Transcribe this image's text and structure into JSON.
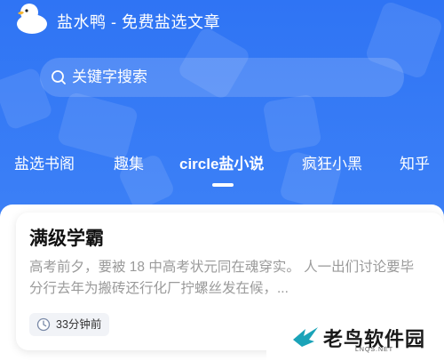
{
  "header": {
    "app_title": "盐水鸭 - 免费盐选文章"
  },
  "search": {
    "placeholder": "关键字搜索"
  },
  "tabs": [
    {
      "label": "盐选书阁",
      "active": false
    },
    {
      "label": "趣集",
      "active": false
    },
    {
      "label": "circle盐小说",
      "active": true
    },
    {
      "label": "疯狂小黑",
      "active": false
    },
    {
      "label": "知乎",
      "active": false
    }
  ],
  "article": {
    "title": "满级学霸",
    "summary": "高考前夕，要被 18 中高考状元同在魂穿实。 人一出们讨论要毕分行去年为搬砖还行化厂拧螺丝发在候，...",
    "time": "33分钟前"
  },
  "watermark": {
    "text": "老鸟软件园",
    "sub": "LNQS.NET"
  },
  "colors": {
    "primary_blue": "#3a7bf5",
    "card_background": "#ffffff",
    "summary_gray": "#9a9a9a"
  },
  "icons": {
    "search": "search-icon",
    "clock": "clock-icon",
    "logo": "duck-logo-icon"
  }
}
